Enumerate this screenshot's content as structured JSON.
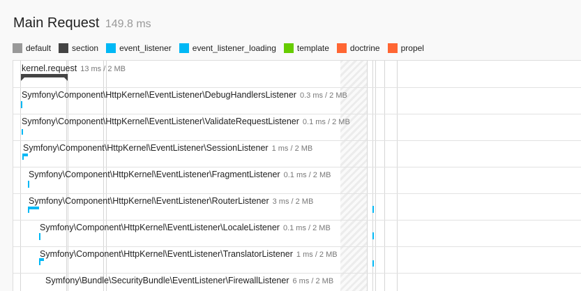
{
  "header": {
    "title": "Main Request",
    "duration": "149.8 ms"
  },
  "legend": [
    {
      "label": "default",
      "color": "#999999"
    },
    {
      "label": "section",
      "color": "#444444"
    },
    {
      "label": "event_listener",
      "color": "#00b8f5"
    },
    {
      "label": "event_listener_loading",
      "color": "#00b8f5"
    },
    {
      "label": "template",
      "color": "#66cc00"
    },
    {
      "label": "doctrine",
      "color": "#ff6633"
    },
    {
      "label": "propel",
      "color": "#ff6633"
    }
  ],
  "rows": [
    {
      "name": "kernel.request",
      "meta": "13 ms / 2 MB",
      "category": "section"
    },
    {
      "name": "Symfony\\Component\\HttpKernel\\EventListener\\DebugHandlersListener",
      "meta": "0.3 ms / 2 MB",
      "category": "event_listener"
    },
    {
      "name": "Symfony\\Component\\HttpKernel\\EventListener\\ValidateRequestListener",
      "meta": "0.1 ms / 2 MB",
      "category": "event_listener"
    },
    {
      "name": "Symfony\\Component\\HttpKernel\\EventListener\\SessionListener",
      "meta": "1 ms / 2 MB",
      "category": "event_listener"
    },
    {
      "name": "Symfony\\Component\\HttpKernel\\EventListener\\FragmentListener",
      "meta": "0.1 ms / 2 MB",
      "category": "event_listener"
    },
    {
      "name": "Symfony\\Component\\HttpKernel\\EventListener\\RouterListener",
      "meta": "3 ms / 2 MB",
      "category": "event_listener"
    },
    {
      "name": "Symfony\\Component\\HttpKernel\\EventListener\\LocaleListener",
      "meta": "0.1 ms / 2 MB",
      "category": "event_listener"
    },
    {
      "name": "Symfony\\Component\\HttpKernel\\EventListener\\TranslatorListener",
      "meta": "1 ms / 2 MB",
      "category": "event_listener"
    },
    {
      "name": "Symfony\\Bundle\\SecurityBundle\\EventListener\\FirewallListener",
      "meta": "6 ms / 2 MB",
      "category": "event_listener"
    }
  ]
}
